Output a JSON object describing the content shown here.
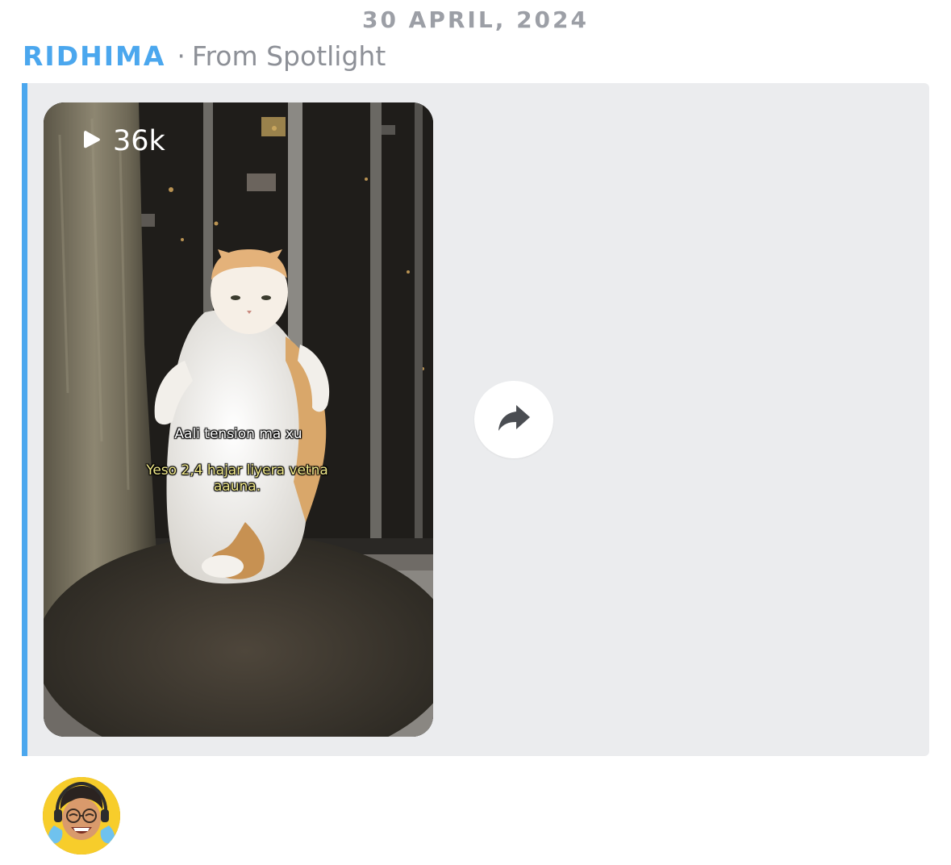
{
  "chat": {
    "date": "30 APRIL, 2024",
    "sender": "RIDHIMA",
    "separator": "·",
    "origin": "From Spotlight"
  },
  "video": {
    "view_count": "36k",
    "caption_line_1": "Aali tension ma xu",
    "caption_line_2": "Yeso 2,4 hajar liyera vetna aauna.",
    "play_icon": "play-icon"
  },
  "actions": {
    "share_icon": "share-arrow-icon"
  },
  "reaction": {
    "icon": "bitmoji-laughing-tears-avatar"
  },
  "colors": {
    "accent": "#4ba7ee",
    "muted_text": "#8d9097",
    "bubble_bg": "#ebecee",
    "caption_yellow": "#f1e98a"
  }
}
